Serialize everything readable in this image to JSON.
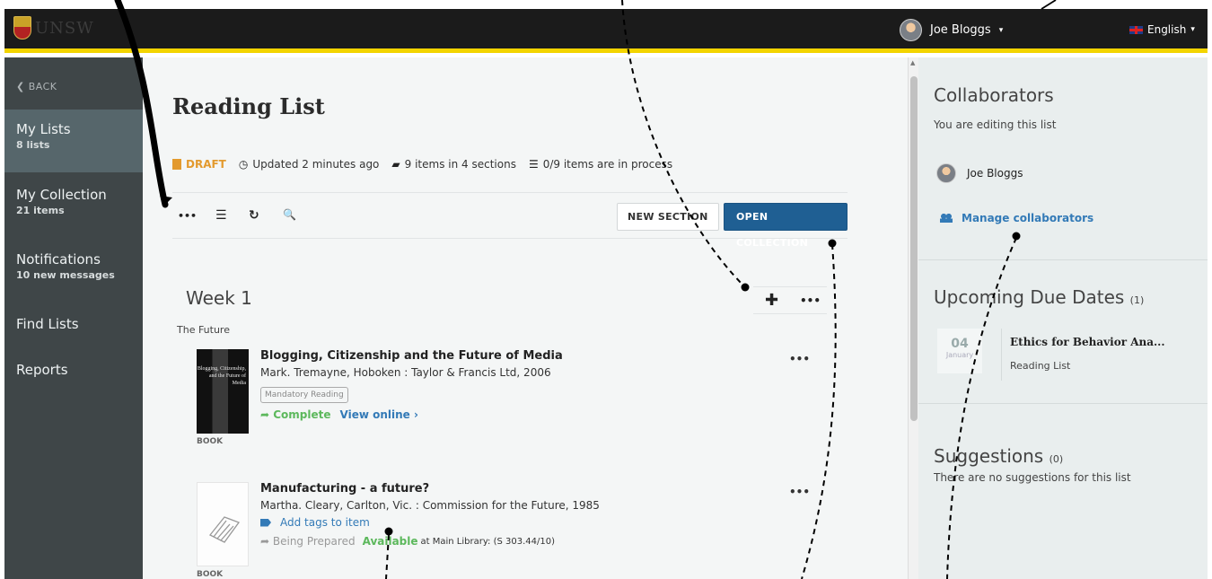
{
  "app": {
    "logo_text": "UNSW"
  },
  "user": {
    "name": "Joe Bloggs",
    "caret": "▾"
  },
  "language": {
    "label": "English",
    "caret": "▾"
  },
  "sidebar": {
    "back": "❮ BACK",
    "items": [
      {
        "label": "My Lists",
        "sub": "8 lists"
      },
      {
        "label": "My Collection",
        "sub": "21 items"
      },
      {
        "label": "Notifications",
        "sub": "10 new messages"
      },
      {
        "label": "Find Lists",
        "sub": ""
      },
      {
        "label": "Reports",
        "sub": ""
      }
    ]
  },
  "main": {
    "title": "Reading List",
    "meta": {
      "status": "DRAFT",
      "updated": "Updated 2 minutes ago",
      "items": "9 items in 4 sections",
      "process": "0/9 items are in process"
    },
    "toolbar": {
      "more_icon": "•••",
      "list_icon": "☰",
      "refresh_icon": "↻",
      "search_icon": "🔍",
      "new_section": "NEW SECTION",
      "open_collection": "OPEN COLLECTION"
    },
    "section": {
      "title": "Week 1",
      "subtitle": "The Future",
      "add_icon": "✚",
      "more_icon": "•••"
    },
    "items": [
      {
        "title": "Blogging, Citizenship and the Future of Media",
        "author": "Mark. Tremayne, Hoboken : Taylor & Francis Ltd, 2006",
        "tag": "Mandatory Reading",
        "status": "➦ Complete",
        "link": "View online ›",
        "type": "BOOK",
        "cover_text": "Blogging, Citizenship, and the Future of Media",
        "more": "•••"
      },
      {
        "title": "Manufacturing - a future?",
        "author": "Martha. Cleary, Carlton, Vic. : Commission for the Future, 1985",
        "add_tags": "Add tags to item",
        "status": "➦ Being Prepared",
        "available": "Available",
        "location": "at Main Library: (S 303.44/10)",
        "type": "BOOK",
        "more": "•••"
      }
    ]
  },
  "right": {
    "collaborators": {
      "title": "Collaborators",
      "subtitle": "You are editing this list",
      "user": "Joe Bloggs",
      "manage": "Manage collaborators"
    },
    "due": {
      "title": "Upcoming Due Dates",
      "count": "(1)",
      "day": "04",
      "month": "January",
      "item_title": "Ethics for Behavior Ana...",
      "item_type": "Reading List"
    },
    "suggestions": {
      "title": "Suggestions",
      "count": "(0)",
      "empty": "There are no suggestions for this list"
    }
  },
  "colors": {
    "topbar": "#1b1b1b",
    "accent": "#f3d400",
    "primary_button": "#1f5f93",
    "draft": "#e39a2e",
    "success": "#5cb85c",
    "link": "#337ab7"
  }
}
